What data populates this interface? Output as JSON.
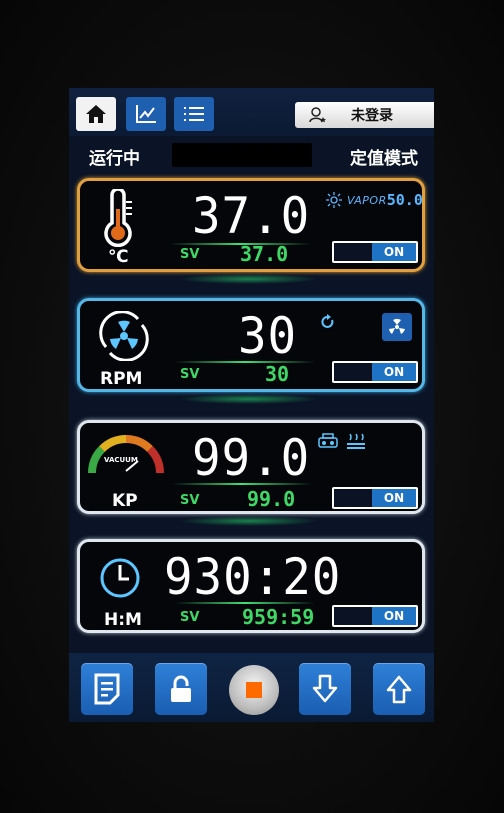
{
  "header": {
    "user_label": "未登录"
  },
  "status": {
    "run_state": "运行中",
    "mode": "定值模式"
  },
  "temperature": {
    "unit": "℃",
    "pv": "37.0",
    "sv_label": "SV",
    "sv": "37.0",
    "toggle": "ON",
    "vapor_label": "VAPOR",
    "vapor_value": "50.0"
  },
  "speed": {
    "unit": "RPM",
    "pv": "30",
    "sv_label": "SV",
    "sv": "30",
    "toggle": "ON"
  },
  "vacuum": {
    "unit": "KP",
    "pv": "99.0",
    "gauge_label": "VACUUM",
    "sv_label": "SV",
    "sv": "99.0",
    "toggle": "ON"
  },
  "timer": {
    "unit": "H:M",
    "pv": "930:20",
    "sv_label": "SV",
    "sv": "959:59",
    "toggle": "ON"
  },
  "colors": {
    "accent_blue": "#1f73c4",
    "value_green": "#3fd866",
    "temp_border": "#e0a040",
    "speed_border": "#55b7e6",
    "stop_orange": "#ff6a00"
  },
  "icons": {
    "nav": [
      "home-icon",
      "chart-icon",
      "list-icon"
    ],
    "toolbar": [
      "document-icon",
      "lock-icon",
      "stop-icon",
      "arrow-down-icon",
      "arrow-up-icon"
    ]
  }
}
